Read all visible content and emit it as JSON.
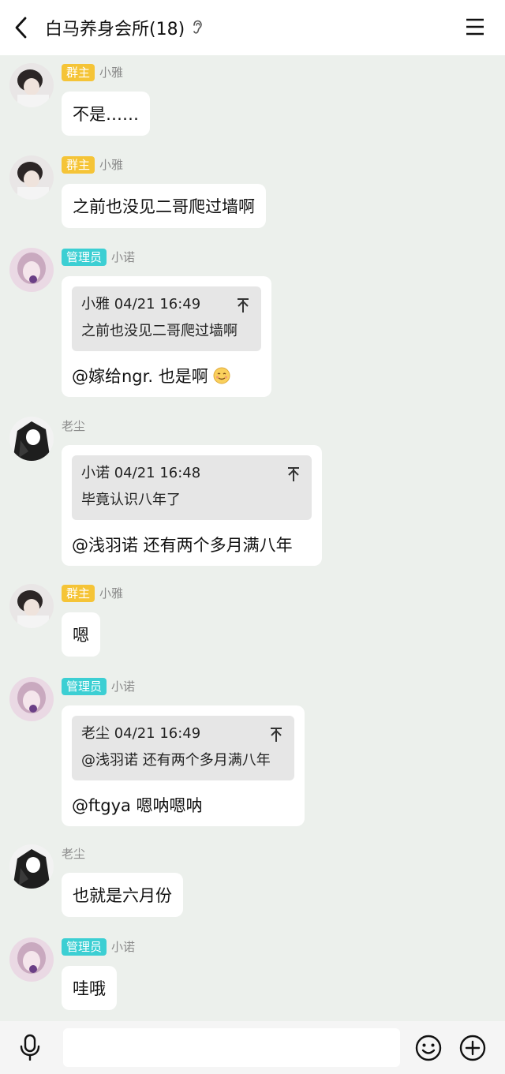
{
  "header": {
    "title": "白马养身会所(18)",
    "icons": [
      "back-arrow-icon",
      "ear-icon",
      "menu-icon"
    ]
  },
  "messages": [
    {
      "badge": "群主",
      "name": "小雅",
      "text": "不是……"
    },
    {
      "badge": "群主",
      "name": "小雅",
      "text": "之前也没见二哥爬过墙啊"
    },
    {
      "badge": "管理员",
      "name": "小诺",
      "quote_header": "小雅 04/21 16:49",
      "quote_text": "之前也没见二哥爬过墙啊",
      "reply": "@嫁给ngr. 也是啊",
      "emoji": "smiling-face-emoji"
    },
    {
      "name": "老尘",
      "quote_header": "小诺 04/21 16:48",
      "quote_text": "毕竟认识八年了",
      "reply": "@浅羽诺 还有两个多月满八年"
    },
    {
      "badge": "群主",
      "name": "小雅",
      "text": "嗯"
    },
    {
      "badge": "管理员",
      "name": "小诺",
      "quote_header": "老尘 04/21 16:49",
      "quote_text": "@浅羽诺 还有两个多月满八年",
      "reply": "@ftgya 嗯呐嗯呐"
    },
    {
      "name": "老尘",
      "text": "也就是六月份"
    },
    {
      "badge": "管理员",
      "name": "小诺",
      "text": "哇哦"
    }
  ],
  "input": {
    "placeholder": "",
    "value": ""
  },
  "colors": {
    "owner_badge": "#f5c437",
    "admin_badge": "#3ccfd3",
    "chat_bg": "#ecf0ec"
  },
  "footer_icons": [
    "microphone-icon",
    "emoji-icon",
    "plus-icon"
  ]
}
